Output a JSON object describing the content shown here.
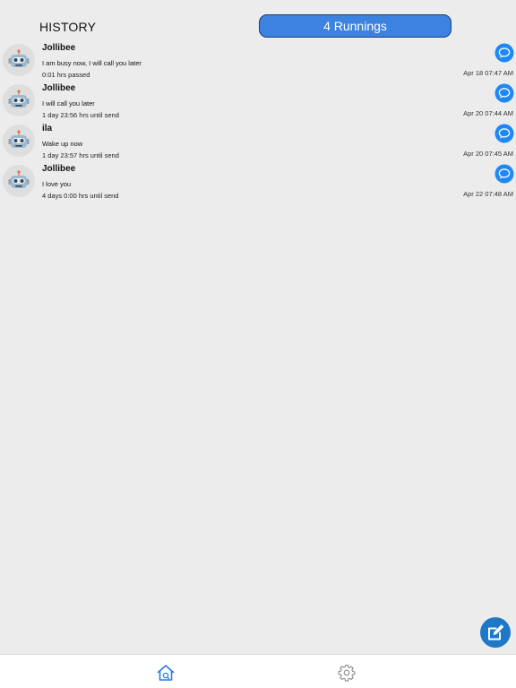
{
  "header": {
    "history_label": "HISTORY",
    "running_label": "4 Runnings"
  },
  "colors": {
    "accent": "#3c82e0",
    "chat_icon": "#1e88f5",
    "background": "#ececec"
  },
  "messages": [
    {
      "name": "Jollibee",
      "message": "I am busy now, I will call you later",
      "status": "0:01 hrs passed",
      "time": "Apr 18 07:47 AM",
      "avatar_icon": "robot-icon"
    },
    {
      "name": "Jollibee",
      "message": "I will call you later",
      "status": "1 day 23:56 hrs until send",
      "time": "Apr 20 07:44 AM",
      "avatar_icon": "robot-icon"
    },
    {
      "name": "ila",
      "message": "Wake up now",
      "status": "1 day 23:57 hrs until send",
      "time": "Apr 20 07:45 AM",
      "avatar_icon": "robot-icon"
    },
    {
      "name": "Jollibee",
      "message": "I love you",
      "status": "4 days 0:00 hrs until send",
      "time": "Apr 22 07:48 AM",
      "avatar_icon": "robot-icon"
    }
  ],
  "fab_icon": "compose-icon",
  "tabbar": {
    "home_icon": "home-icon",
    "settings_icon": "gear-icon"
  }
}
